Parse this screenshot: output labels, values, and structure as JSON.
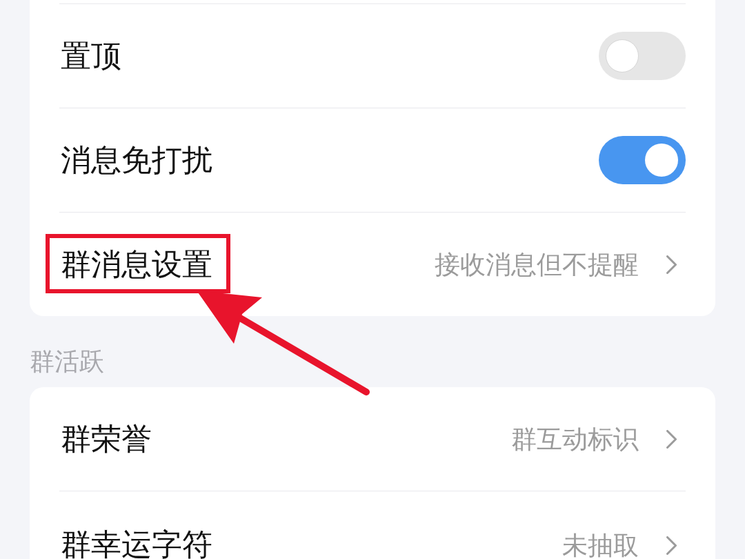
{
  "sections": [
    {
      "rows": [
        {
          "kind": "toggle",
          "label": "置顶",
          "on": false,
          "highlighted": false
        },
        {
          "kind": "toggle",
          "label": "消息免打扰",
          "on": true,
          "highlighted": false
        },
        {
          "kind": "link",
          "label": "群消息设置",
          "value": "接收消息但不提醒",
          "highlighted": true
        }
      ]
    },
    {
      "title": "群活跃",
      "rows": [
        {
          "kind": "link",
          "label": "群荣誉",
          "value": "群互动标识",
          "highlighted": false
        },
        {
          "kind": "link",
          "label": "群幸运字符",
          "value": "未抽取",
          "highlighted": false
        }
      ]
    }
  ]
}
